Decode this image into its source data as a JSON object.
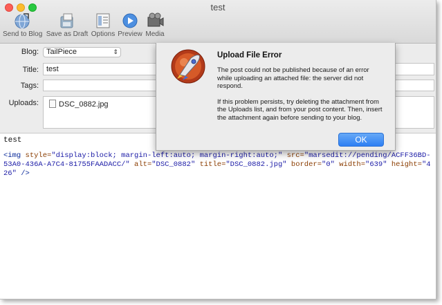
{
  "window": {
    "title": "test"
  },
  "toolbar": {
    "items": [
      {
        "label": "Send to Blog",
        "icon": "send-to-blog-icon"
      },
      {
        "label": "Save as Draft",
        "icon": "save-as-draft-icon"
      },
      {
        "label": "Options",
        "icon": "options-icon"
      },
      {
        "label": "Preview",
        "icon": "preview-icon"
      },
      {
        "label": "Media",
        "icon": "media-icon"
      }
    ]
  },
  "form": {
    "blog_label": "Blog:",
    "blog_value": "TailPiece",
    "title_label": "Title:",
    "title_value": "test",
    "tags_label": "Tags:",
    "tags_value": "",
    "uploads_label": "Uploads:",
    "uploads_files": [
      "DSC_0882.jpg"
    ]
  },
  "editor": {
    "title": "test",
    "code": {
      "open": "<img ",
      "style_attr": "style=",
      "style_val": "\"display:block; margin-left:auto; margin-right:auto;\"",
      "src_attr": " src=",
      "src_val": "\"marsedit://pending/ACFF36BD-53A0-436A-A7C4-81755FAADACC/\"",
      "alt_attr": " alt=",
      "alt_val": "\"DSC_0882\"",
      "title_attr": " title=",
      "title_val": "\"DSC_0882.jpg\"",
      "border_attr": " border=",
      "border_val": "\"0\"",
      "width_attr": " width=",
      "width_val": "\"639\"",
      "height_attr": " height=",
      "height_val": "\"426\"",
      "close": " />"
    }
  },
  "dialog": {
    "title": "Upload File Error",
    "message_1": "The post could not be published because of an error while uploading an attached file: the server did not respond.",
    "message_2": "If this problem persists, try deleting the attachment from the Uploads list, and from your post content. Then, insert the attachment again before sending to your blog.",
    "ok_label": "OK",
    "icon": "rocket-app-icon"
  },
  "colors": {
    "accent": "#2d7ff4",
    "close": "#fc5f57",
    "minimize": "#fdbc2e",
    "maximize": "#28c840"
  }
}
